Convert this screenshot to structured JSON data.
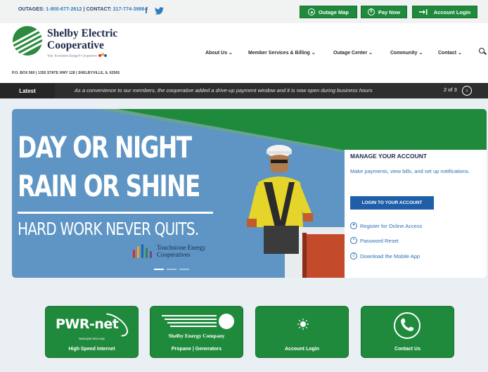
{
  "topbar": {
    "outages_label": "OUTAGES:",
    "outages_phone": "1-800-677-2612",
    "contact_label": "CONTACT:",
    "contact_phone": "217-774-3986",
    "buttons": [
      {
        "label": "Outage Map",
        "icon": "map-pin-icon"
      },
      {
        "label": "Pay Now",
        "icon": "dollar-icon"
      },
      {
        "label": "Account Login",
        "icon": "login-icon"
      }
    ]
  },
  "header": {
    "logo_line1": "Shelby Electric",
    "logo_line2": "Cooperative",
    "logo_tagline": "Your Touchstone Energy® Cooperative",
    "address": "P.O. BOX 560  |  1355 STATE HWY 128  |  SHELBYVILLE, IL 62565",
    "nav": [
      {
        "label": "About Us ⌄"
      },
      {
        "label": "Member Services & Billing ⌄"
      },
      {
        "label": "Outage Center ⌄"
      },
      {
        "label": "Community ⌄"
      },
      {
        "label": "Contact ⌄"
      }
    ]
  },
  "latest": {
    "label": "Latest",
    "message": "As a convenience to our members, the cooperative added a drive-up payment window and it is now open during business hours",
    "counter": "2 of 3",
    "next_icon": "›"
  },
  "hero": {
    "line1": "DAY OR NIGHT",
    "line2": "RAIN OR SHINE",
    "line3": "HARD WORK NEVER QUITS.",
    "partner_line1": "Touchstone Energy",
    "partner_line2": "Cooperatives",
    "colors": {
      "sky": "#5e95c4",
      "green": "#1f8a3c"
    }
  },
  "account": {
    "title": "MANAGE YOUR ACCOUNT",
    "description": "Make payments, view bills, and set up notifications.",
    "login_button": "LOGIN TO YOUR ACCOUNT",
    "links": [
      {
        "label": "Register for Online Access",
        "icon": "user-icon"
      },
      {
        "label": "Password Reset",
        "icon": "lock-icon"
      },
      {
        "label": "Download the Mobile App",
        "icon": "mobile-icon"
      }
    ]
  },
  "tiles": [
    {
      "caption": "High Speed Internet",
      "brand": "PWR-net",
      "url": "www.pwr-net.coop"
    },
    {
      "caption": "Propane | Generators",
      "brand": "Shelby Energy Company"
    },
    {
      "caption": "Account Login"
    },
    {
      "caption": "Contact Us"
    }
  ]
}
